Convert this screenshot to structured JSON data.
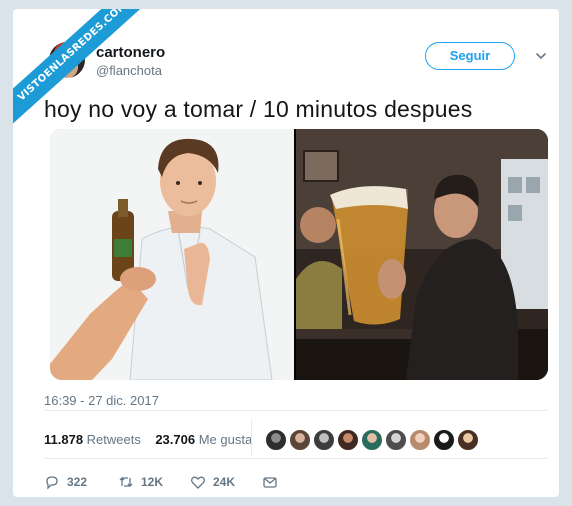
{
  "watermark": "VISTOENLASREDES.COM",
  "user": {
    "name": "cartonero",
    "handle": "@flanchota"
  },
  "follow_label": "Seguir",
  "tweet_text": "hoy no voy a tomar / 10 minutos despues",
  "timestamp": "16:39 - 27 dic. 2017",
  "stats": {
    "retweets_count": "11.878",
    "retweets_label": "Retweets",
    "likes_count": "23.706",
    "likes_label": "Me gusta"
  },
  "actions": {
    "replies": "322",
    "retweets": "12K",
    "likes": "24K"
  },
  "colors": {
    "accent": "#1da1f2",
    "ribbon": "#1d9bd6",
    "muted": "#657786"
  },
  "icons": [
    "chevron-down-icon",
    "reply-icon",
    "retweet-icon",
    "heart-icon",
    "message-icon"
  ]
}
